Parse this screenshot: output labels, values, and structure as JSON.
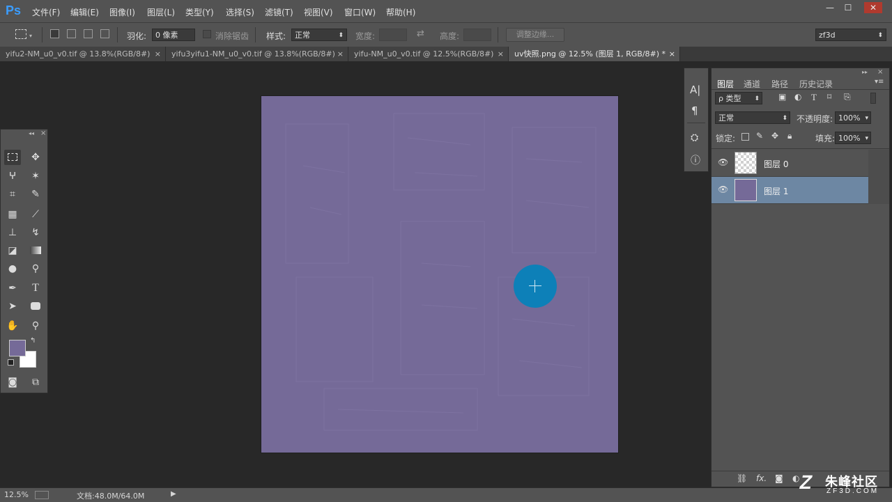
{
  "app": {
    "logo": "Ps"
  },
  "menu": [
    "文件(F)",
    "编辑(E)",
    "图像(I)",
    "图层(L)",
    "类型(Y)",
    "选择(S)",
    "滤镜(T)",
    "视图(V)",
    "窗口(W)",
    "帮助(H)"
  ],
  "window_controls": {
    "minimize": "—",
    "maximize": "☐",
    "close": "✕"
  },
  "options": {
    "feather_label": "羽化:",
    "feather_value": "0 像素",
    "antialias_label": "消除锯齿",
    "style_label": "样式:",
    "style_value": "正常",
    "width_label": "宽度:",
    "height_label": "高度:",
    "refine_edge": "调整边缘...",
    "workspace": "zf3d"
  },
  "tabs": [
    {
      "label": "yifu2-NM_u0_v0.tif @ 13.8%(RGB/8#)",
      "active": false
    },
    {
      "label": "yifu3yifu1-NM_u0_v0.tif @ 13.8%(RGB/8#)",
      "active": false
    },
    {
      "label": "yifu-NM_u0_v0.tif @ 12.5%(RGB/8#)",
      "active": false
    },
    {
      "label": "uv快照.png @ 12.5% (图层 1, RGB/8#) *",
      "active": true
    }
  ],
  "tab_close": "×",
  "canvas": {
    "fill": "#756a98",
    "brush_color": "#0d80b8"
  },
  "toolbox": {
    "collapse": "◂◂",
    "close": "×",
    "foreground": "#756a98",
    "background": "#ffffff"
  },
  "layers_panel": {
    "collapse": "▸▸",
    "close": "×",
    "menu": "▾≡",
    "tabs": [
      "图层",
      "通道",
      "路径",
      "历史记录"
    ],
    "filter_label": "ρ 类型",
    "blend_mode": "正常",
    "opacity_label": "不透明度:",
    "opacity_value": "100%",
    "lock_label": "锁定:",
    "fill_label": "填充:",
    "fill_value": "100%",
    "layers": [
      {
        "name": "图层 0",
        "selected": false,
        "transparent": true
      },
      {
        "name": "图层 1",
        "selected": true,
        "transparent": false
      }
    ],
    "footer_fx": "fx."
  },
  "status": {
    "zoom": "12.5%",
    "doc": "文档:48.0M/64.0M",
    "arrow": "▶"
  },
  "watermark": {
    "brand": "朱峰社区",
    "url": "ZF3D.COM"
  }
}
